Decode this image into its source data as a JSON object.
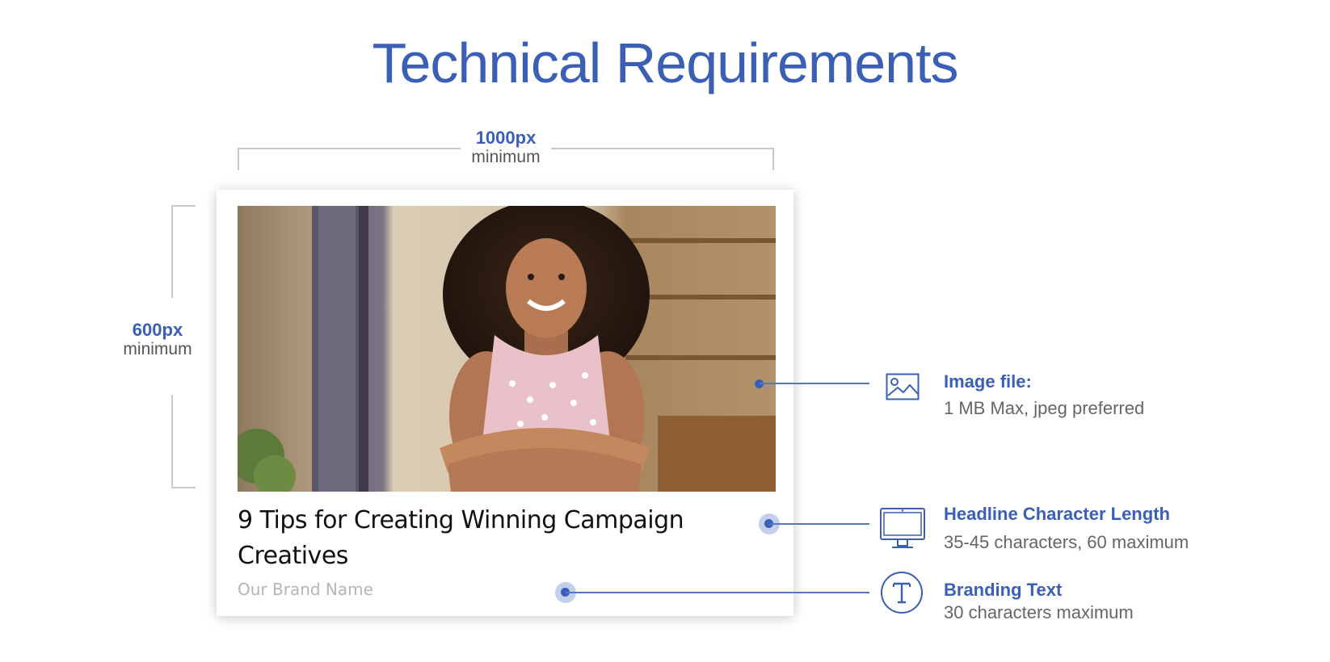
{
  "title": "Technical Requirements",
  "colors": {
    "accent": "#3a5fb5",
    "muted": "#666666",
    "bracket": "#c9c9c9"
  },
  "width_dimension": {
    "value": "1000px",
    "label": "minimum"
  },
  "height_dimension": {
    "value": "600px",
    "label": "minimum"
  },
  "card": {
    "headline": "9 Tips for Creating Winning Campaign Creatives",
    "brand": "Our Brand Name",
    "photo": "photo-of-smiling-woman"
  },
  "callouts": [
    {
      "icon": "image-icon",
      "title": "Image file:",
      "desc": "1 MB Max, jpeg preferred"
    },
    {
      "icon": "monitor-icon",
      "title": "Headline Character Length",
      "desc": "35-45 characters, 60 maximum"
    },
    {
      "icon": "text-t-icon",
      "title": "Branding Text",
      "desc": "30 characters maximum"
    }
  ]
}
